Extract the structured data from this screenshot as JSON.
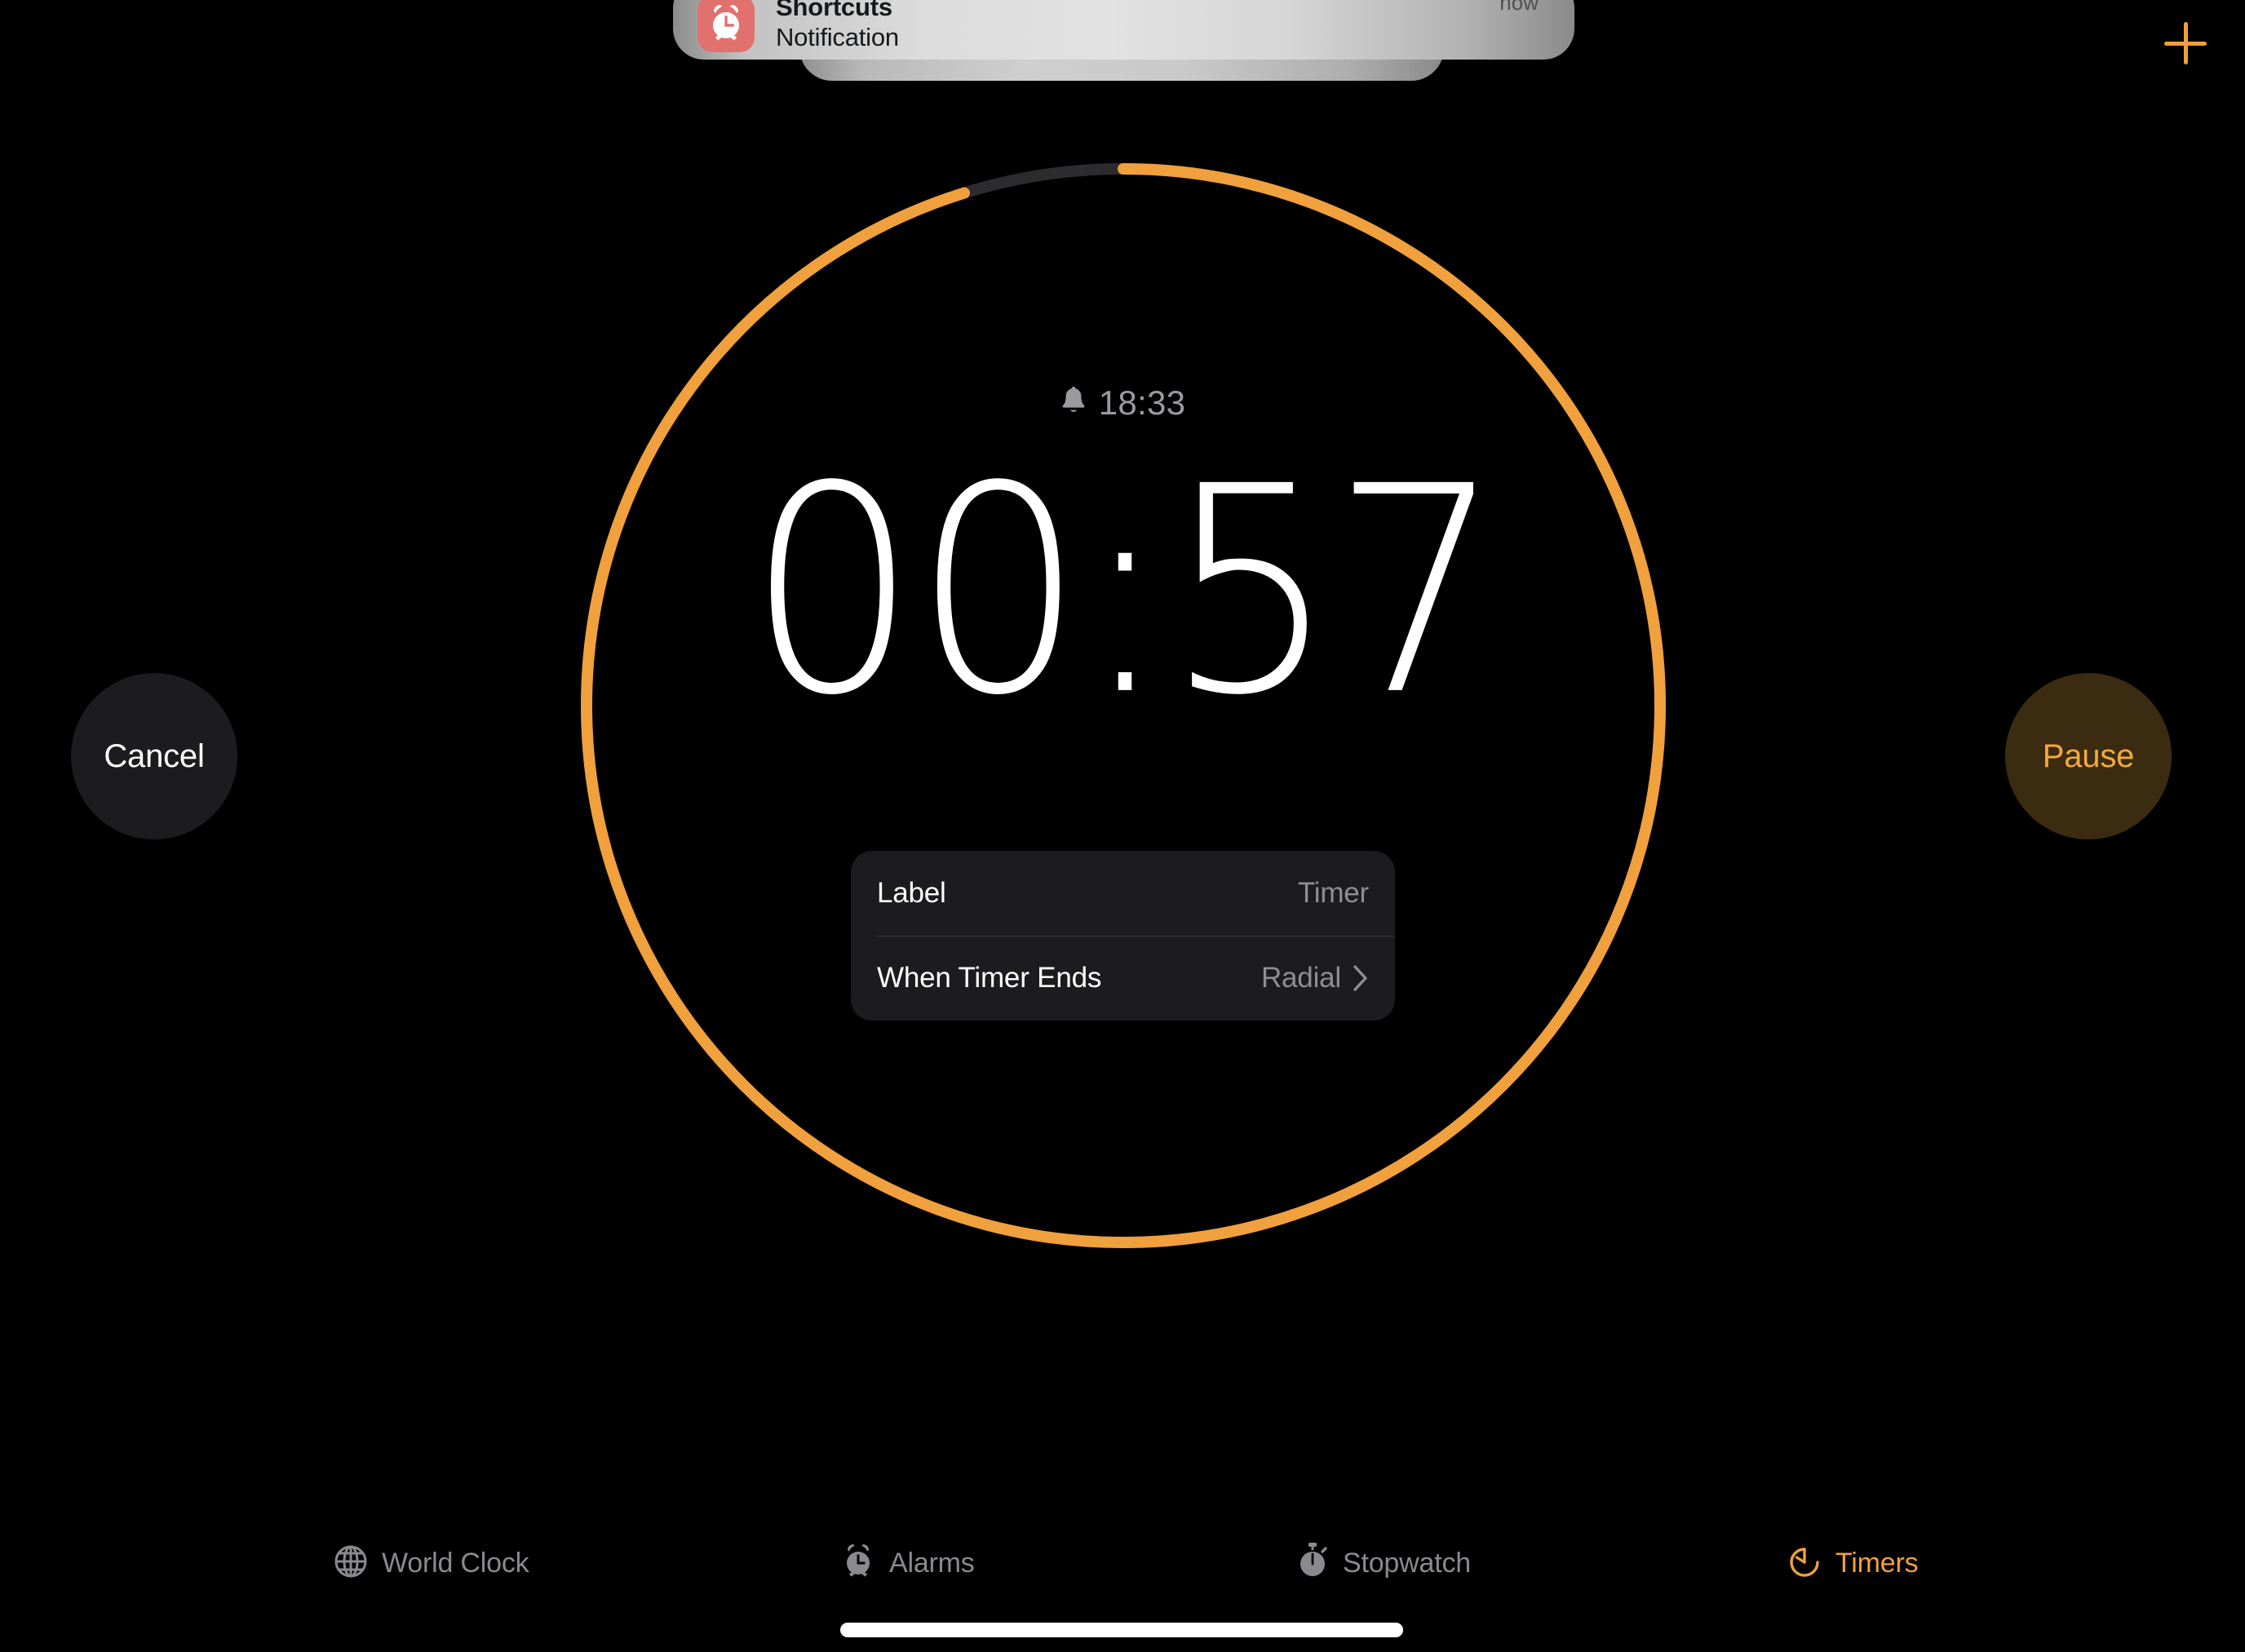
{
  "app": {
    "name": "Clock",
    "background_color": "#000000",
    "accent_color": "#F0A03C"
  },
  "notification": {
    "app_icon": "alarm-clock-icon",
    "app_icon_color": "#E1716E",
    "title": "Shortcuts",
    "body": "Notification",
    "time": "now",
    "stacked_count": 2
  },
  "header": {
    "add_button_label": "+",
    "add_button_icon": "plus-icon",
    "add_button_color": "#F0A03C"
  },
  "timer": {
    "end_time_icon": "bell-icon",
    "end_time": "18:33",
    "countdown": "00:57",
    "ring": {
      "progress_color": "#F0A03C",
      "track_color": "#2C2C2E",
      "remaining_fraction": 0.048,
      "elapsed_fraction": 0.952,
      "stroke_width": 14
    },
    "settings": [
      {
        "label": "Label",
        "value": "Timer",
        "chevron": false
      },
      {
        "label": "When Timer Ends",
        "value": "Radial",
        "chevron": true,
        "chevron_icon": "chevron-right-icon"
      }
    ],
    "controls": {
      "cancel_label": "Cancel",
      "pause_label": "Pause"
    }
  },
  "tabbar": {
    "items": [
      {
        "label": "World Clock",
        "icon": "globe-icon",
        "active": false
      },
      {
        "label": "Alarms",
        "icon": "alarm-clock-icon",
        "active": false
      },
      {
        "label": "Stopwatch",
        "icon": "stopwatch-icon",
        "active": false
      },
      {
        "label": "Timers",
        "icon": "timer-icon",
        "active": true
      }
    ]
  }
}
